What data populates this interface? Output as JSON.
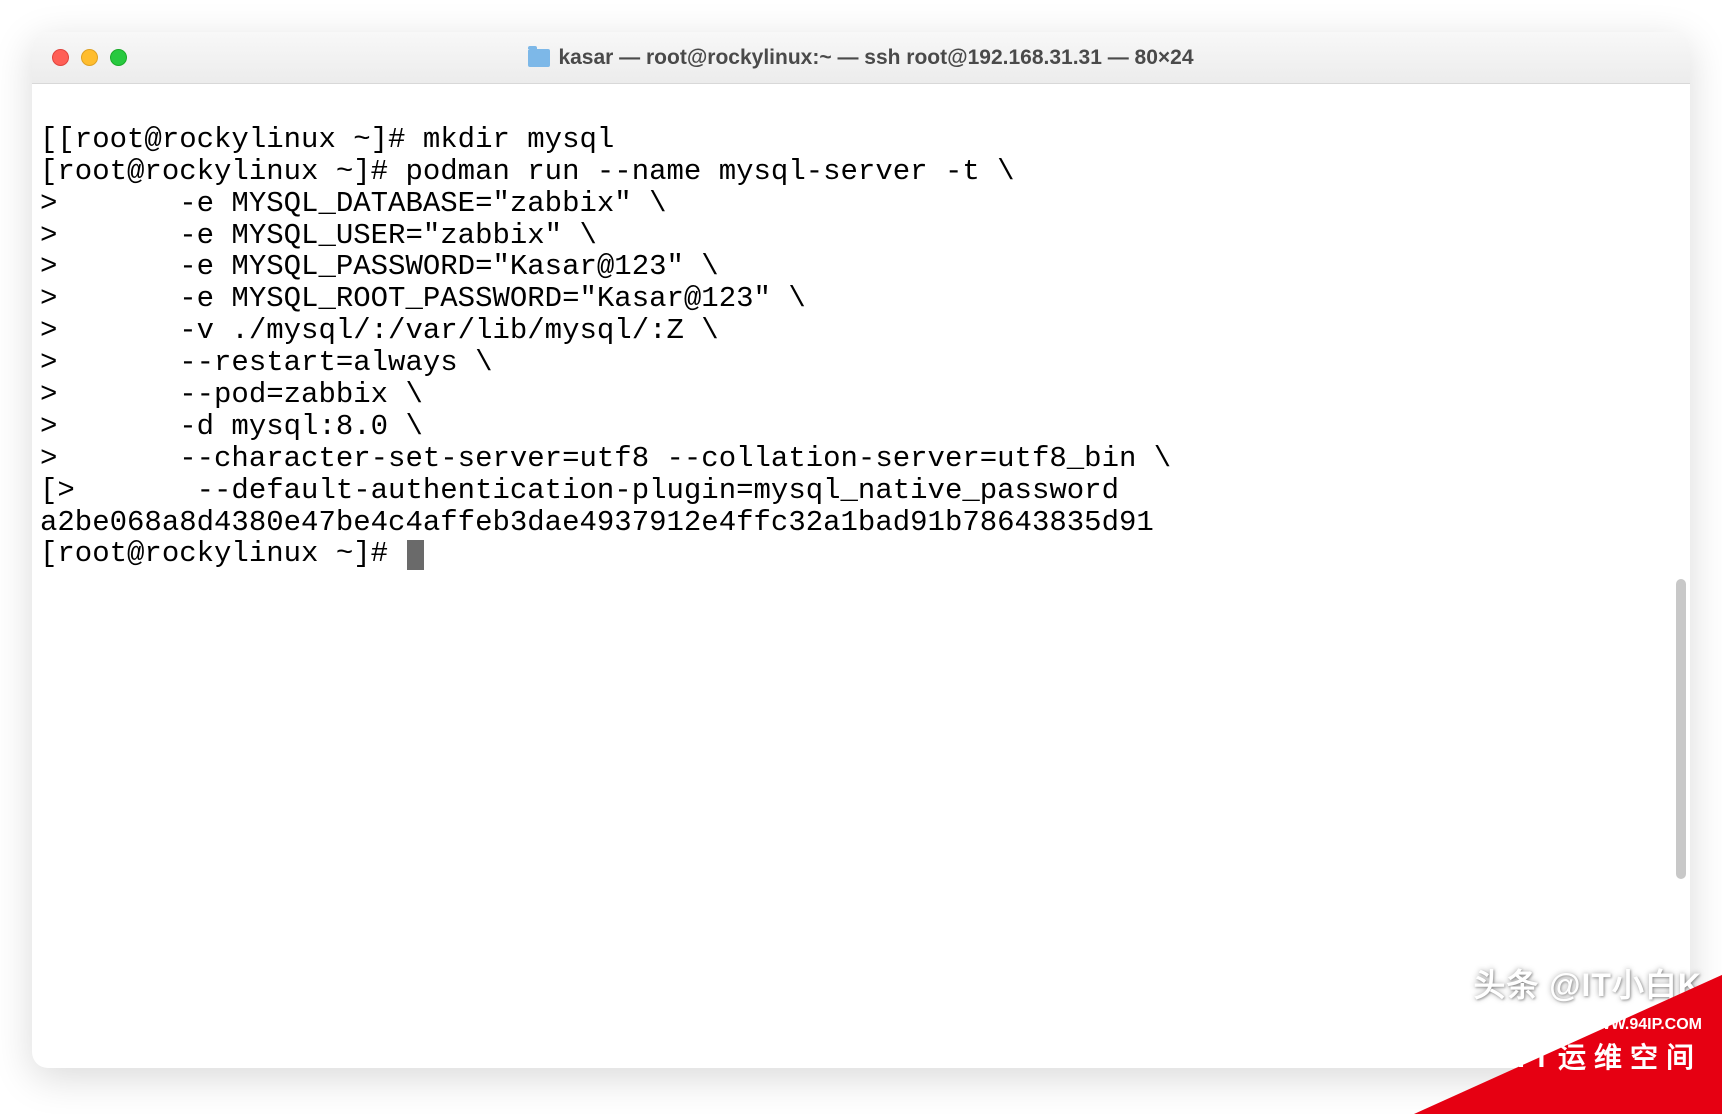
{
  "window": {
    "title": "kasar — root@rockylinux:~ — ssh root@192.168.31.31 — 80×24"
  },
  "terminal": {
    "lines": [
      "[[root@rockylinux ~]# mkdir mysql",
      "[root@rockylinux ~]# podman run --name mysql-server -t \\",
      ">       -e MYSQL_DATABASE=\"zabbix\" \\",
      ">       -e MYSQL_USER=\"zabbix\" \\",
      ">       -e MYSQL_PASSWORD=\"Kasar@123\" \\",
      ">       -e MYSQL_ROOT_PASSWORD=\"Kasar@123\" \\",
      ">       -v ./mysql/:/var/lib/mysql/:Z \\",
      ">       --restart=always \\",
      ">       --pod=zabbix \\",
      ">       -d mysql:8.0 \\",
      ">       --character-set-server=utf8 --collation-server=utf8_bin \\",
      "[>       --default-authentication-plugin=mysql_native_password",
      "a2be068a8d4380e47be4c4affeb3dae4937912e4ffc32a1bad91b78643835d91",
      "[root@rockylinux ~]# "
    ]
  },
  "watermark": {
    "top_text": "头条 @IT小白K",
    "url": "WWW.94IP.COM",
    "bottom_text": "IT运维空间"
  }
}
